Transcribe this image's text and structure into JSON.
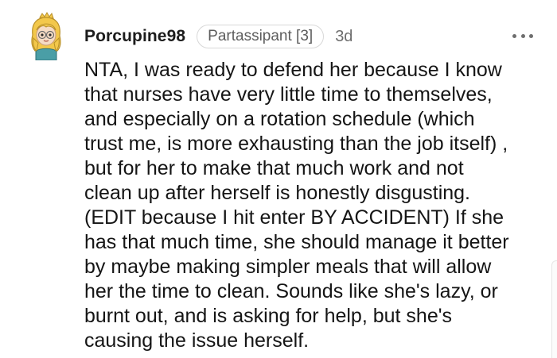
{
  "comment": {
    "username": "Porcupine98",
    "flair": "Partassipant [3]",
    "timestamp": "3d",
    "avatar_icon": "avatar-girl-icon",
    "more_icon": "more-options-icon",
    "body_lines": [
      "NTA, I was ready to defend her because I know",
      "that nurses have very little time to themselves,",
      "and especially on a rotation schedule (which",
      "trust me, is more exhausting than the job itself) ,",
      "but for her to make that much work and not",
      "clean up after herself is honestly disgusting.",
      "(EDIT because I hit enter BY ACCIDENT) If she",
      "has that much time, she should manage it better",
      "by maybe making simpler meals that will allow",
      "her the time to clean. Sounds like she's lazy, or",
      "burnt out, and is asking for help, but she's",
      "causing the issue herself."
    ]
  },
  "colors": {
    "text": "#151515",
    "meta": "#6d6d6d",
    "flair_border": "#d8d8d8",
    "avatar_hair": "#f3c84b",
    "avatar_shirt": "#4a9ea6"
  }
}
